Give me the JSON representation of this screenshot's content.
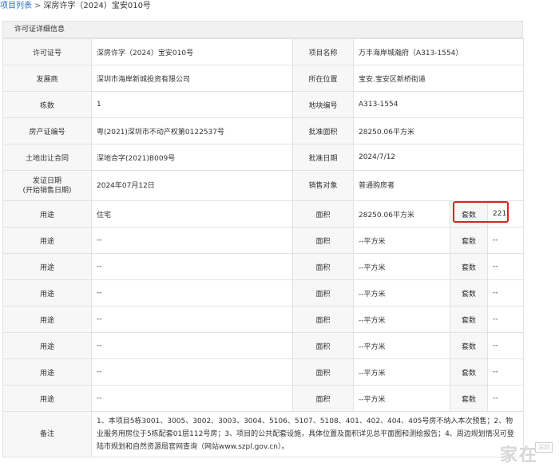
{
  "breadcrumb": {
    "link": "项目列表",
    "sep": ">",
    "current": "深房许字（2024）宝安010号"
  },
  "section_title": "许可证详细信息",
  "labels": {
    "permit_no": "许可证号",
    "project_name": "项目名称",
    "developer": "发展商",
    "location": "所在位置",
    "buildings": "栋数",
    "parcel_no": "地块编号",
    "cert_no": "房产证编号",
    "approved_area": "批准面积",
    "land_contract": "土地出让合同",
    "approval_date": "批准日期",
    "issue_date_1": "发证日期",
    "issue_date_2": "(开始销售日期)",
    "sales_target": "销售对象",
    "usage": "用途",
    "area": "面积",
    "units": "套数",
    "remarks": "备注"
  },
  "values": {
    "permit_no": "深房许字（2024）宝安010号",
    "project_name": "万丰海岸城瀚府（A313-1554）",
    "developer": "深圳市海岸新城投资有限公司",
    "location": "宝安.宝安区新桥街道",
    "buildings": "1",
    "parcel_no": "A313-1554",
    "cert_no": "粤(2021)深圳市不动产权第0122537号",
    "approved_area": "28250.06平方米",
    "land_contract": "深地合字(2021)B009号",
    "approval_date": "2024/7/12",
    "issue_date": "2024年07月12日",
    "sales_target": "普通购房者",
    "remarks": "1、本项目5栋3001、3005、3002、3003、3004、5106、5107、5108、401、402、404、405号房不纳入本次预售；2、物业服务用房位于5栋配套01层112号房；3、项目的公共配套设施，具体位置及面积详见总平面图和测绘报告；4、周边规划情况可登陆市规划和自然资源局官网查询（网站www.szpl.gov.cn）。"
  },
  "usage_rows": [
    {
      "usage": "住宅",
      "area": "28250.06平方米",
      "units": "221"
    },
    {
      "usage": "--",
      "area": "--平方米",
      "units": "--"
    },
    {
      "usage": "--",
      "area": "--平方米",
      "units": "--"
    },
    {
      "usage": "--",
      "area": "--平方米",
      "units": "--"
    },
    {
      "usage": "--",
      "area": "--平方米",
      "units": "--"
    },
    {
      "usage": "--",
      "area": "--平方米",
      "units": "--"
    },
    {
      "usage": "--",
      "area": "--平方米",
      "units": "--"
    },
    {
      "usage": "--",
      "area": "--平方米",
      "units": "--"
    }
  ],
  "watermark": {
    "text": "家在",
    "small": "深圳"
  },
  "colors": {
    "link": "#2a6fc9",
    "highlight": "#e02020",
    "label_bg": "#f7f7f7",
    "header_bg": "#f1f1f1",
    "border": "#e2e2e2"
  }
}
